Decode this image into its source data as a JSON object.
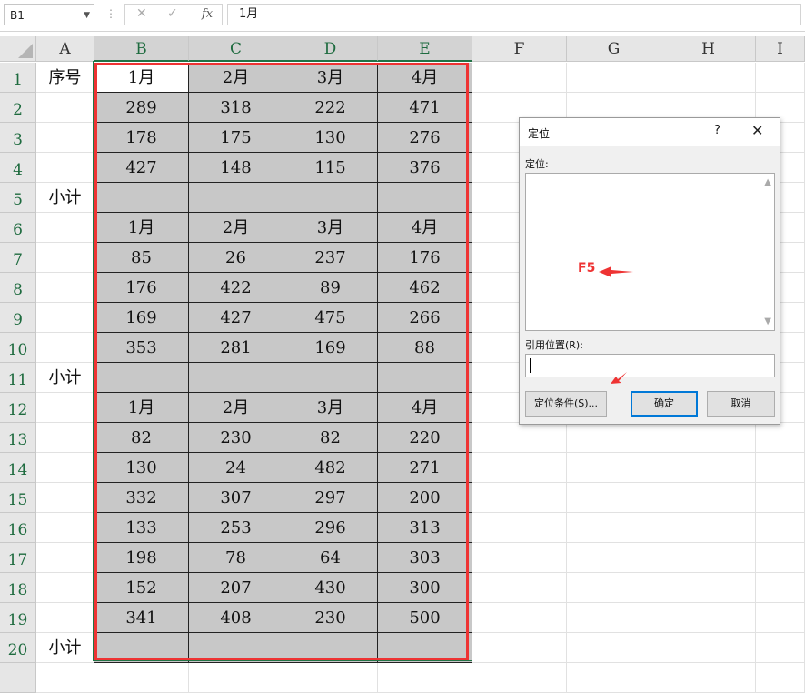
{
  "formula_bar": {
    "name_box": "B1",
    "content": "1月"
  },
  "columns": [
    "A",
    "B",
    "C",
    "D",
    "E",
    "F",
    "G",
    "H",
    "I"
  ],
  "rows": [
    "1",
    "2",
    "3",
    "4",
    "5",
    "6",
    "7",
    "8",
    "9",
    "10",
    "11",
    "12",
    "13",
    "14",
    "15",
    "16",
    "17",
    "18",
    "19",
    "20"
  ],
  "col_a": [
    "序号",
    "",
    "",
    "",
    "小计",
    "",
    "",
    "",
    "",
    "",
    "小计",
    "",
    "",
    "",
    "",
    "",
    "",
    "",
    "",
    "小计"
  ],
  "data": [
    [
      "1月",
      "2月",
      "3月",
      "4月"
    ],
    [
      "289",
      "318",
      "222",
      "471"
    ],
    [
      "178",
      "175",
      "130",
      "276"
    ],
    [
      "427",
      "148",
      "115",
      "376"
    ],
    [
      "",
      "",
      "",
      ""
    ],
    [
      "1月",
      "2月",
      "3月",
      "4月"
    ],
    [
      "85",
      "26",
      "237",
      "176"
    ],
    [
      "176",
      "422",
      "89",
      "462"
    ],
    [
      "169",
      "427",
      "475",
      "266"
    ],
    [
      "353",
      "281",
      "169",
      "88"
    ],
    [
      "",
      "",
      "",
      ""
    ],
    [
      "1月",
      "2月",
      "3月",
      "4月"
    ],
    [
      "82",
      "230",
      "82",
      "220"
    ],
    [
      "130",
      "24",
      "482",
      "271"
    ],
    [
      "332",
      "307",
      "297",
      "200"
    ],
    [
      "133",
      "253",
      "296",
      "313"
    ],
    [
      "198",
      "78",
      "64",
      "303"
    ],
    [
      "152",
      "207",
      "430",
      "300"
    ],
    [
      "341",
      "408",
      "230",
      "500"
    ],
    [
      "",
      "",
      "",
      ""
    ]
  ],
  "dialog": {
    "title": "定位",
    "help": "?",
    "goto_label": "定位:",
    "annotation": "F5",
    "ref_label": "引用位置(R):",
    "ref_value": "",
    "special_button": "定位条件(S)...",
    "ok_button": "确定",
    "cancel_button": "取消"
  },
  "colors": {
    "selection_fill": "#c8c8c8",
    "highlight_border": "#ee3333",
    "selection_border": "#217346",
    "default_button_border": "#0078d7"
  }
}
